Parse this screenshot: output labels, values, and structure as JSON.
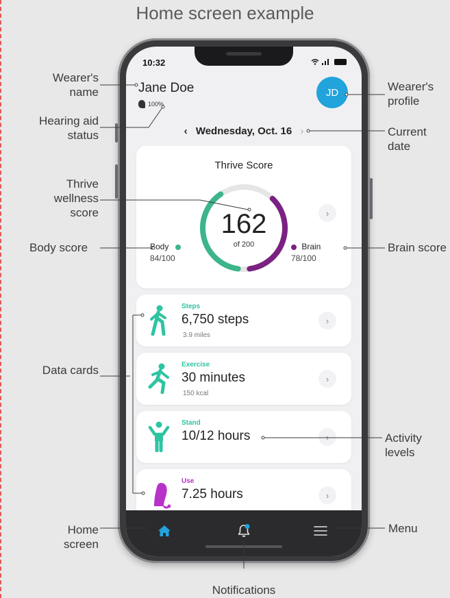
{
  "page": {
    "title": "Home screen example"
  },
  "status_bar": {
    "time": "10:32"
  },
  "header": {
    "user_name": "Jane Doe",
    "hearing_aid_battery": "100%",
    "avatar_initials": "JD",
    "date": "Wednesday, Oct. 16"
  },
  "thrive_card": {
    "title": "Thrive Score",
    "score": "162",
    "score_max_label": "of 200",
    "body": {
      "label": "Body",
      "value": "84/100",
      "score": 84,
      "max": 100,
      "color": "#3cb58a"
    },
    "brain": {
      "label": "Brain",
      "value": "78/100",
      "score": 78,
      "max": 100,
      "color": "#7a2182"
    }
  },
  "data_cards": [
    {
      "category": "Steps",
      "value": "6,750 steps",
      "sub": "3.9 miles",
      "accent": "#2ec4a2",
      "icon": "walking-person-icon"
    },
    {
      "category": "Exercise",
      "value": "30 minutes",
      "sub": "150 kcal",
      "accent": "#2ec4a2",
      "icon": "running-person-icon"
    },
    {
      "category": "Stand",
      "value": "10/12 hours",
      "sub": "",
      "accent": "#2ec4a2",
      "icon": "standing-person-icon"
    },
    {
      "category": "Use",
      "value": "7.25 hours",
      "sub": "",
      "accent": "#b832c9",
      "icon": "hearing-aid-icon"
    }
  ],
  "tab_bar": {
    "items": [
      "home-icon",
      "bell-icon",
      "menu-icon"
    ],
    "active_color": "#21a3dc",
    "notification_dot_color": "#21a3dc"
  },
  "callouts": {
    "wearers_name": "Wearer's name",
    "hearing_aid_status": "Hearing aid status",
    "thrive_wellness_score": "Thrive wellness score",
    "body_score": "Body score",
    "data_cards": "Data cards",
    "home_screen": "Home screen",
    "wearers_profile": "Wearer's profile",
    "current_date": "Current date",
    "brain_score": "Brain score",
    "activity_levels": "Activity levels",
    "menu": "Menu",
    "notifications": "Notifications"
  },
  "colors": {
    "accent_blue": "#21a3dc",
    "body_green": "#3cb58a",
    "brain_purple": "#7a2182",
    "steps_teal": "#2ec4a2",
    "use_magenta": "#b832c9"
  }
}
